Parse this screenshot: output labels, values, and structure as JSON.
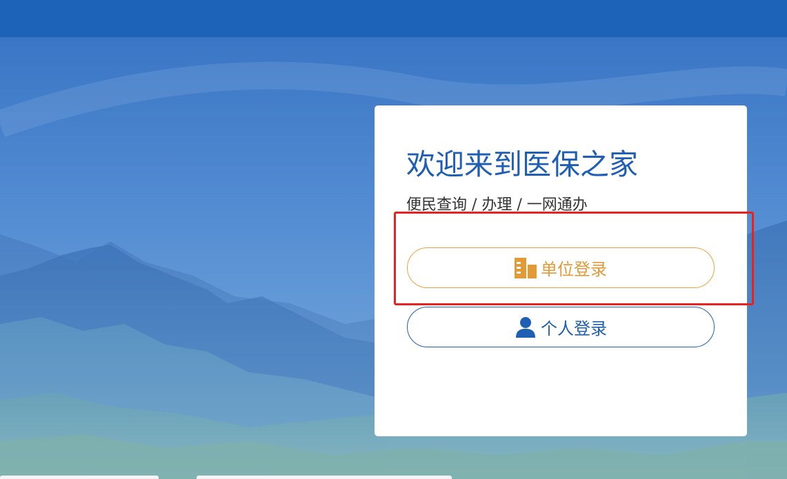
{
  "card": {
    "title": "欢迎来到医保之家",
    "subtitle": "便民查询 / 办理 / 一网通办"
  },
  "buttons": {
    "unit_login": {
      "label": "单位登录",
      "icon": "building-icon",
      "color": "#e39a35"
    },
    "personal_login": {
      "label": "个人登录",
      "icon": "user-icon",
      "color": "#1e5fb4"
    }
  },
  "colors": {
    "header": "#1d64b8",
    "accent_blue": "#1e5fb4",
    "accent_orange": "#e39a35",
    "highlight_red": "#e8231f"
  }
}
